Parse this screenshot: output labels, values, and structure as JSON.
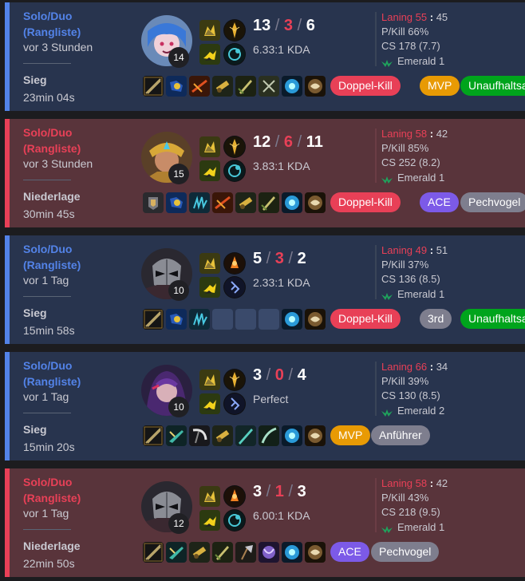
{
  "matches": [
    {
      "outcome": "win",
      "mode": "Solo/Duo",
      "mode_sub": "(Rangliste)",
      "ago": "vor 3 Stunden",
      "result": "Sieg",
      "duration": "23min 04s",
      "champion_icon": "blue-haired-champion-portrait",
      "level": "14",
      "summoner_spells": [
        "ghost-icon",
        "flash-icon"
      ],
      "runes": [
        "lethal-tempo-rune-icon",
        "sorcery-rune-icon"
      ],
      "kills": "13",
      "deaths": "3",
      "assists": "6",
      "kda_ratio": "6.33:1 KDA",
      "laning_label": "Laning",
      "laning_self": "55",
      "laning_opp": "45",
      "pkill": "P/Kill 66%",
      "cs": "CS 178 (7.7)",
      "rank": "Emerald 1",
      "items": [
        "sword-item-icon",
        "boots-item-icon",
        "bow-item-icon",
        "cannon-item-icon",
        "blade-item-icon",
        "dagger-item-icon",
        "ward-trinket-icon",
        "lens-trinket-icon"
      ],
      "badges": [
        {
          "label": "Doppel-Kill",
          "color": "#e84057"
        },
        {
          "label": "MVP",
          "color": "#e89a04"
        },
        {
          "label": "Unaufhaltsam",
          "color": "#00a41c"
        }
      ]
    },
    {
      "outcome": "loss",
      "mode": "Solo/Duo",
      "mode_sub": "(Rangliste)",
      "ago": "vor 3 Stunden",
      "result": "Niederlage",
      "duration": "30min 45s",
      "champion_icon": "golden-armored-champion-portrait",
      "level": "15",
      "summoner_spells": [
        "ghost-icon",
        "flash-icon"
      ],
      "runes": [
        "lethal-tempo-rune-icon",
        "sorcery-rune-icon"
      ],
      "kills": "12",
      "deaths": "6",
      "assists": "11",
      "kda_ratio": "3.83:1 KDA",
      "laning_label": "Laning",
      "laning_self": "58",
      "laning_opp": "42",
      "pkill": "P/Kill 85%",
      "cs": "CS 252 (8.2)",
      "rank": "Emerald 1",
      "items": [
        "armor-item-icon",
        "boots-item-icon",
        "claw-item-icon",
        "bow-item-icon",
        "cannon-item-icon",
        "blade-item-icon",
        "ward-trinket-icon",
        "lens-trinket-icon"
      ],
      "badges": [
        {
          "label": "Doppel-Kill",
          "color": "#e84057"
        },
        {
          "label": "ACE",
          "color": "#7c5ae8"
        },
        {
          "label": "Pechvogel",
          "color": "#7e7e8e"
        }
      ]
    },
    {
      "outcome": "win",
      "mode": "Solo/Duo",
      "mode_sub": "(Rangliste)",
      "ago": "vor 1 Tag",
      "result": "Sieg",
      "duration": "15min 58s",
      "champion_icon": "masked-champion-portrait",
      "level": "10",
      "summoner_spells": [
        "ghost-icon",
        "flash-icon"
      ],
      "runes": [
        "conqueror-rune-icon",
        "inspiration-rune-icon"
      ],
      "kills": "5",
      "deaths": "3",
      "assists": "2",
      "kda_ratio": "2.33:1 KDA",
      "laning_label": "Laning",
      "laning_self": "49",
      "laning_opp": "51",
      "pkill": "P/Kill 37%",
      "cs": "CS 136 (8.5)",
      "rank": "Emerald 1",
      "items": [
        "sword-item-icon",
        "boots-item-icon",
        "claw-item-icon",
        "",
        "",
        "",
        "ward-trinket-icon",
        "lens-trinket-icon"
      ],
      "badges": [
        {
          "label": "Doppel-Kill",
          "color": "#e84057"
        },
        {
          "label": "3rd",
          "color": "#7e7e8e"
        },
        {
          "label": "Unaufhaltsam",
          "color": "#00a41c"
        }
      ]
    },
    {
      "outcome": "win",
      "mode": "Solo/Duo",
      "mode_sub": "(Rangliste)",
      "ago": "vor 1 Tag",
      "result": "Sieg",
      "duration": "15min 20s",
      "champion_icon": "purple-haired-champion-portrait",
      "level": "10",
      "summoner_spells": [
        "ghost-icon",
        "flash-icon"
      ],
      "runes": [
        "lethal-tempo-rune-icon",
        "inspiration-rune-icon"
      ],
      "kills": "3",
      "deaths": "0",
      "assists": "4",
      "kda_ratio": "Perfect",
      "laning_label": "Laning",
      "laning_self": "66",
      "laning_opp": "34",
      "pkill": "P/Kill 39%",
      "cs": "CS 130 (8.5)",
      "rank": "Emerald 2",
      "items": [
        "sword-item-icon",
        "teal-blade-item-icon",
        "scythe-item-icon",
        "cannon-item-icon",
        "teal-sword-item-icon",
        "curved-blade-item-icon",
        "ward-trinket-icon",
        "lens-trinket-icon"
      ],
      "badges": [
        {
          "label": "MVP",
          "color": "#e89a04"
        },
        {
          "label": "Anführer",
          "color": "#7e7e8e"
        }
      ]
    },
    {
      "outcome": "loss",
      "mode": "Solo/Duo",
      "mode_sub": "(Rangliste)",
      "ago": "vor 1 Tag",
      "result": "Niederlage",
      "duration": "22min 50s",
      "champion_icon": "masked-champion-portrait",
      "level": "12",
      "summoner_spells": [
        "ghost-icon",
        "flash-icon"
      ],
      "runes": [
        "conqueror-rune-icon",
        "sorcery-rune-icon"
      ],
      "kills": "3",
      "deaths": "1",
      "assists": "3",
      "kda_ratio": "6.00:1 KDA",
      "laning_label": "Laning",
      "laning_self": "58",
      "laning_opp": "42",
      "pkill": "P/Kill 43%",
      "cs": "CS 218 (9.5)",
      "rank": "Emerald 1",
      "items": [
        "sword-item-icon",
        "teal-blade-item-icon",
        "cannon-item-icon",
        "blade-item-icon",
        "axe-item-icon",
        "purple-orb-item-icon",
        "ward-trinket-icon",
        "lens-trinket-icon"
      ],
      "badges": [
        {
          "label": "ACE",
          "color": "#7c5ae8"
        },
        {
          "label": "Pechvogel",
          "color": "#7e7e8e"
        }
      ]
    }
  ]
}
